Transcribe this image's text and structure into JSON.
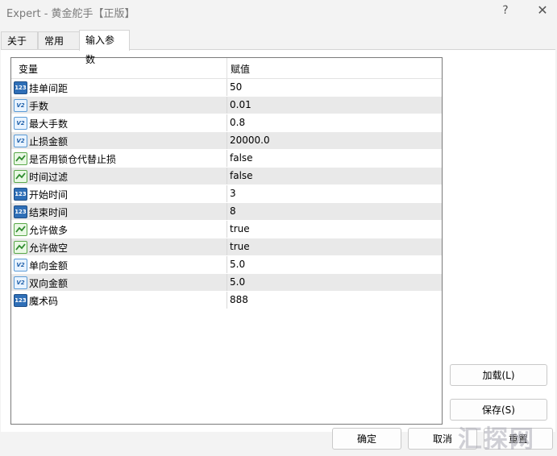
{
  "window": {
    "title": "Expert - 黄金舵手【正版】",
    "help": "?",
    "close": "✕"
  },
  "tabs": [
    {
      "label": "关于"
    },
    {
      "label": "常用"
    },
    {
      "label": "输入参数",
      "active": true
    }
  ],
  "table": {
    "headers": {
      "variable": "变量",
      "value": "赋值"
    },
    "rows": [
      {
        "icon": "integer-icon",
        "name": "挂单间距",
        "value": "50"
      },
      {
        "icon": "double-icon",
        "name": "手数",
        "value": "0.01"
      },
      {
        "icon": "double-icon",
        "name": "最大手数",
        "value": "0.8"
      },
      {
        "icon": "double-icon",
        "name": "止损金额",
        "value": "20000.0"
      },
      {
        "icon": "boolean-icon",
        "name": "是否用锁仓代替止损",
        "value": "false"
      },
      {
        "icon": "boolean-icon",
        "name": "时间过滤",
        "value": "false"
      },
      {
        "icon": "integer-icon",
        "name": "开始时间",
        "value": "3"
      },
      {
        "icon": "integer-icon",
        "name": "结束时间",
        "value": "8"
      },
      {
        "icon": "boolean-icon",
        "name": "允许做多",
        "value": "true"
      },
      {
        "icon": "boolean-icon",
        "name": "允许做空",
        "value": "true"
      },
      {
        "icon": "double-icon",
        "name": "单向金额",
        "value": "5.0"
      },
      {
        "icon": "double-icon",
        "name": "双向金额",
        "value": "5.0"
      },
      {
        "icon": "integer-icon",
        "name": "魔术码",
        "value": "888"
      }
    ]
  },
  "buttons": {
    "load": "加载(L)",
    "save": "保存(S)",
    "ok": "确定",
    "cancel": "取消",
    "reset": "重置"
  },
  "icon_text": {
    "integer": "123",
    "double": "V2"
  },
  "watermark": "汇探网"
}
